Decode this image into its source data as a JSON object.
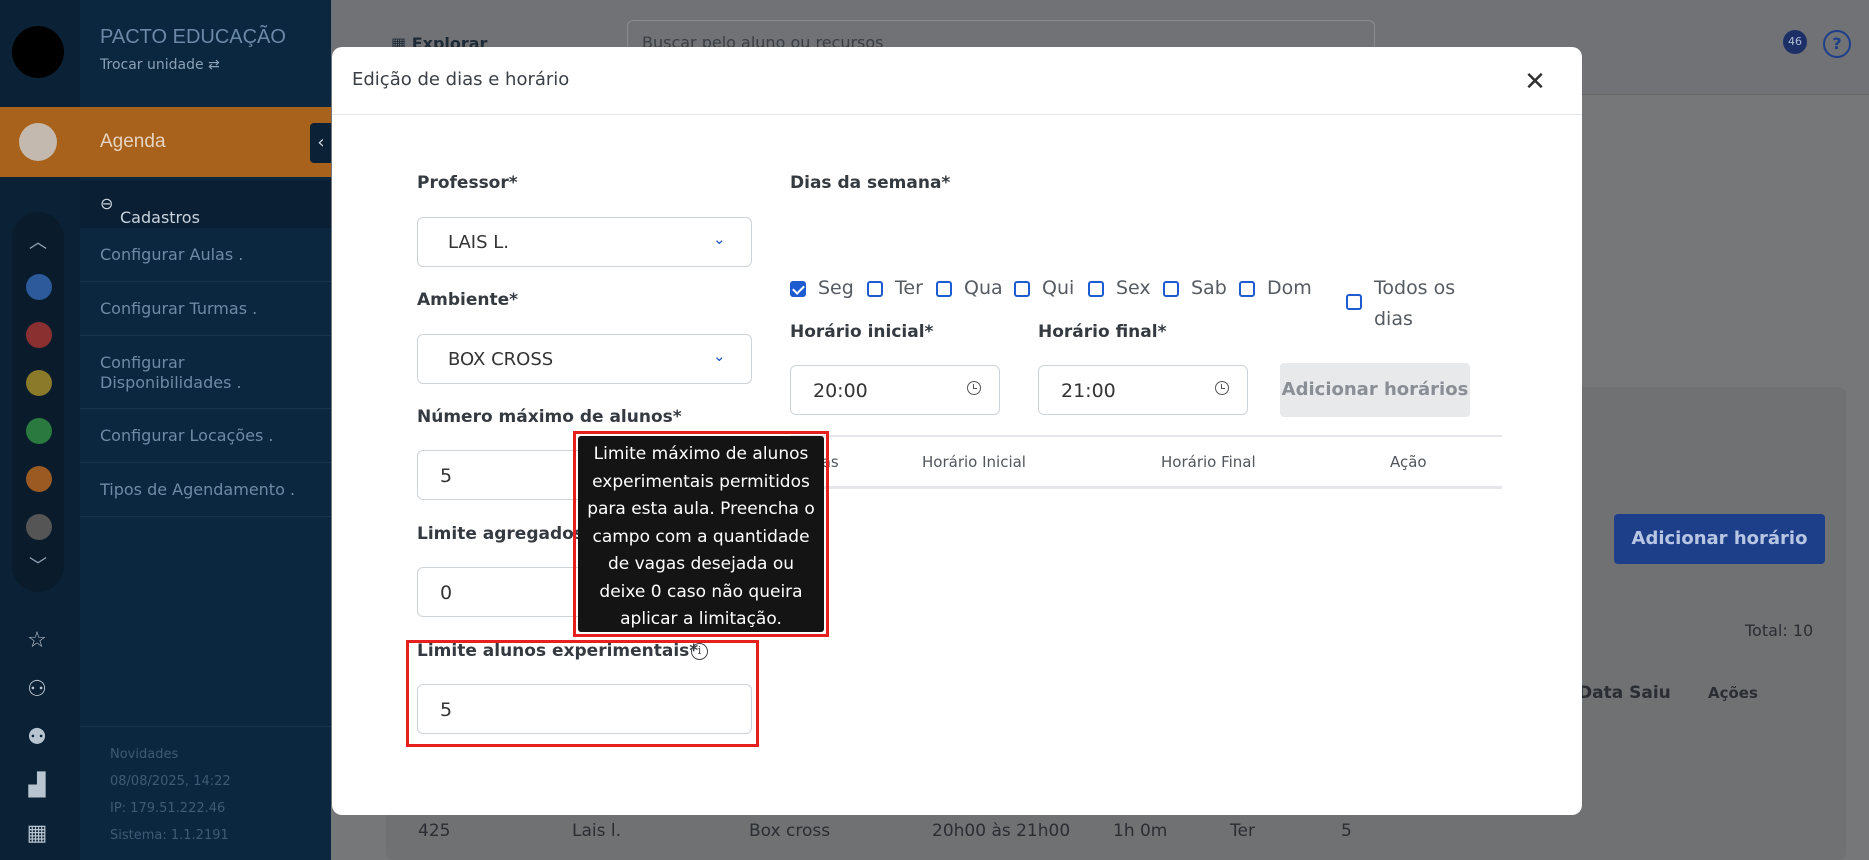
{
  "sidebar": {
    "brand": "PACTO EDUCAÇÃO",
    "switch_unit": "Trocar unidade ⇄",
    "module": "Agenda",
    "section": "Cadastros",
    "items": [
      {
        "label": "Configurar Aulas ."
      },
      {
        "label": "Configurar Turmas ."
      },
      {
        "label": "Configurar Disponibilidades ."
      },
      {
        "label": "Configurar Locações ."
      },
      {
        "label": "Tipos de Agendamento ."
      }
    ],
    "info": {
      "news": "Novidades",
      "date": "08/08/2025, 14:22",
      "ip": "IP: 179.51.222.46",
      "system": "Sistema: 1.1.2191"
    }
  },
  "topbar": {
    "explore": "Explorar",
    "search_placeholder": "Buscar pelo aluno ou recursos",
    "notifications_count": "46"
  },
  "background": {
    "add_schedule_button": "Adicionar horário",
    "total": "Total: 10",
    "col_left": "Data Saiu",
    "col_actions": "Ações",
    "row": [
      "425",
      "Lais l.",
      "Box cross",
      "20h00 às 21h00",
      "1h 0m",
      "Ter",
      "5"
    ]
  },
  "modal": {
    "title": "Edição de dias e horário",
    "professor": {
      "label": "Professor*",
      "value": "LAIS L."
    },
    "ambiente": {
      "label": "Ambiente*",
      "value": "BOX CROSS"
    },
    "max_alunos": {
      "label": "Número máximo de alunos*",
      "value": "5"
    },
    "limite_agregados": {
      "label": "Limite agregados*",
      "value": "0"
    },
    "limite_experimentais": {
      "label": "Limite alunos experimentais*",
      "value": "5"
    },
    "dias_label": "Dias da semana*",
    "days": [
      {
        "label": "Seg",
        "checked": true
      },
      {
        "label": "Ter",
        "checked": false
      },
      {
        "label": "Qua",
        "checked": false
      },
      {
        "label": "Qui",
        "checked": false
      },
      {
        "label": "Sex",
        "checked": false
      },
      {
        "label": "Sab",
        "checked": false
      },
      {
        "label": "Dom",
        "checked": false
      }
    ],
    "all_days": {
      "line1": "Todos os",
      "line2": "dias",
      "checked": false
    },
    "horario_inicial": {
      "label": "Horário inicial*",
      "value": "20:00"
    },
    "horario_final": {
      "label": "Horário final*",
      "value": "21:00"
    },
    "add_times_button": "Adicionar horários",
    "table_headers": [
      "Dias",
      "Horário Inicial",
      "Horário Final",
      "Ação"
    ],
    "tooltip": "Limite máximo de alunos experimentais permitidos para esta aula. Preencha o campo com a quantidade de vagas desejada ou deixe 0 caso não queira aplicar a limitação."
  },
  "colors": {
    "accent": "#1d5bd0",
    "highlight": "#e61f1f",
    "agenda_orange": "#a8621c"
  }
}
